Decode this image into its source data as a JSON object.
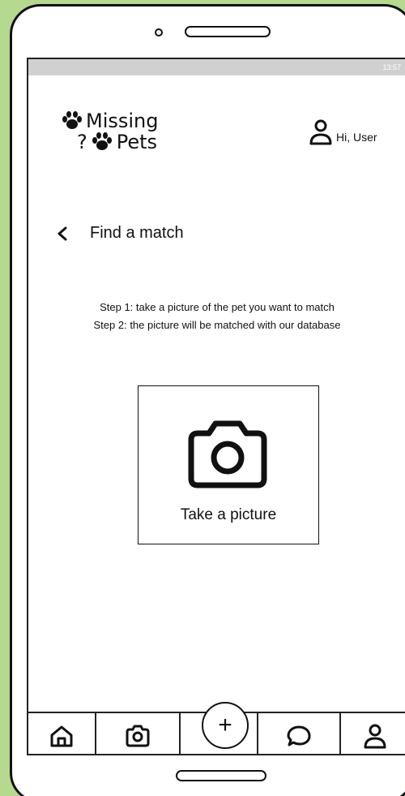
{
  "status_bar": {
    "time": "13:57"
  },
  "app": {
    "name_line1": "Missing",
    "name_line2": "Pets",
    "name_prefix": "?"
  },
  "user": {
    "greeting": "Hi, User"
  },
  "page": {
    "title": "Find a match"
  },
  "instructions": {
    "step1": "Step 1: take a picture of the pet you want to match",
    "step2": "Step 2: the picture will be matched with our database"
  },
  "capture": {
    "label": "Take a picture"
  },
  "nav": {
    "items": [
      "home-icon",
      "camera-icon",
      "plus-icon",
      "chat-icon",
      "profile-icon"
    ],
    "fab_symbol": "+"
  },
  "colors": {
    "background": "#b5d98e",
    "ink": "#111111",
    "status_bar": "#d0d0d0"
  }
}
